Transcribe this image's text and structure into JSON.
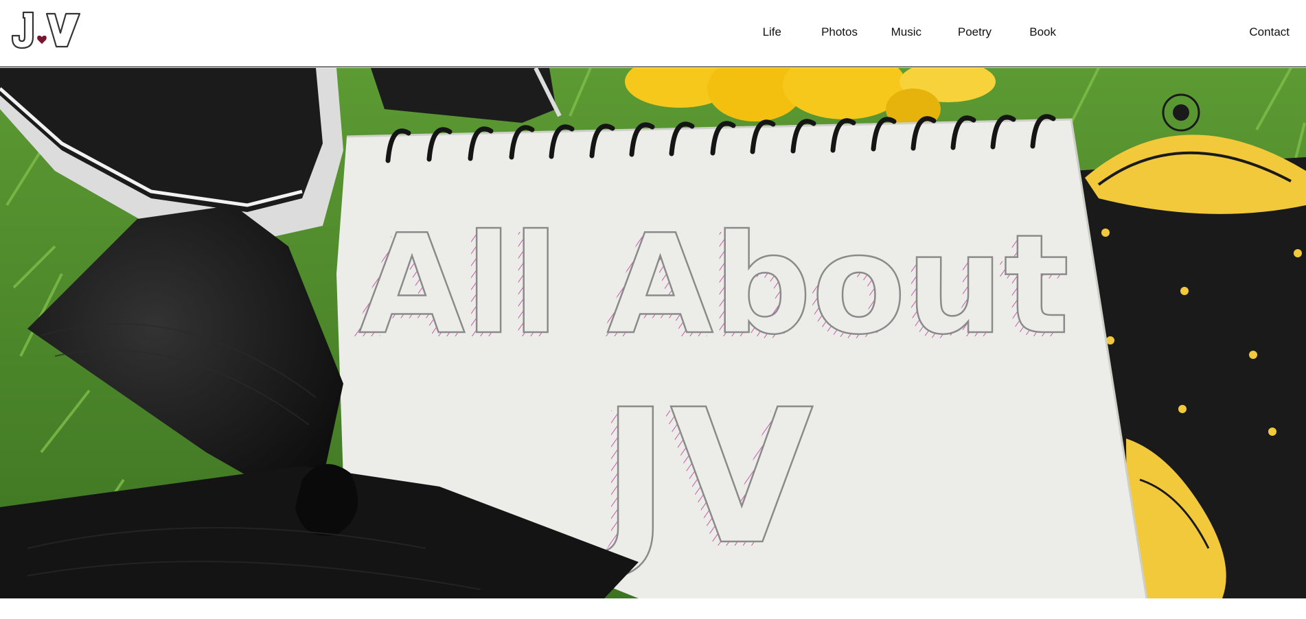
{
  "site": {
    "logo_text": "JV"
  },
  "nav": {
    "items": [
      {
        "label": "Life"
      },
      {
        "label": "Photos"
      },
      {
        "label": "Music"
      },
      {
        "label": "Poetry"
      },
      {
        "label": "Book"
      },
      {
        "label": "Contact"
      }
    ]
  },
  "hero": {
    "line1": "All About",
    "line2": "JV"
  },
  "colors": {
    "grass": "#4f8b2a",
    "paper": "#ecece8",
    "bow": "#161616",
    "gold": "#f1c93a",
    "sunflower": "#f6c81b",
    "hatch": "#c24aa6"
  }
}
